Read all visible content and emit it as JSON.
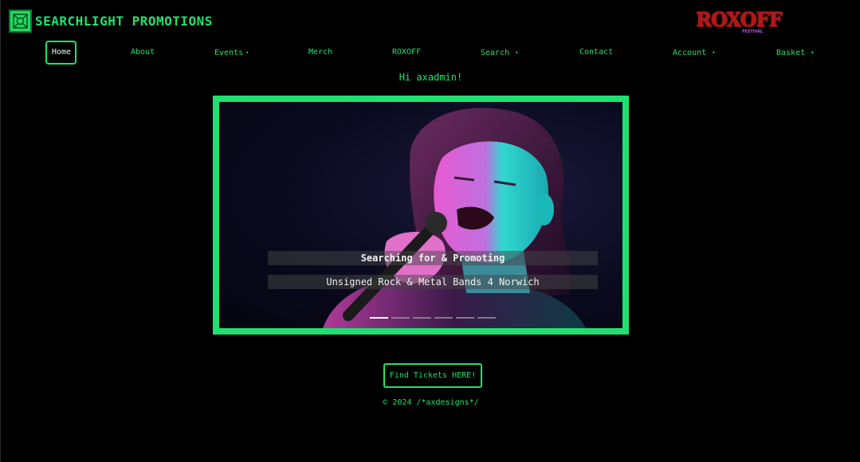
{
  "brand": {
    "name": "SEARCHLIGHT PROMOTIONS",
    "logo_icon": "searchlight-emblem",
    "partner_logo_text": "ROXOFF",
    "partner_logo_sub": "FESTIVAL"
  },
  "nav": {
    "items": [
      {
        "label": "Home",
        "active": true
      },
      {
        "label": "About"
      },
      {
        "label": "Events",
        "dropdown": true
      },
      {
        "label": "Merch"
      },
      {
        "label": "ROXOFF"
      },
      {
        "label": "Search",
        "dropdown": true
      },
      {
        "label": "Contact"
      },
      {
        "label": "Account",
        "dropdown": true
      },
      {
        "label": "Basket",
        "dropdown": true
      }
    ],
    "caret_icon": "▾"
  },
  "greeting": "Hi axadmin!",
  "carousel": {
    "caption_title": "Searching for & Promoting",
    "caption_text": "Unsigned Rock & Metal Bands 4 Norwich",
    "slide_count": 6,
    "active_slide": 1
  },
  "cta": {
    "label": "Find Tickets HERE!"
  },
  "footer": {
    "copyright": "© 2024 /*axdesigns*/"
  },
  "colors": {
    "accent": "#22e06a",
    "frame": "#1fe070",
    "background": "#000000",
    "partner_logo": "#b01818"
  }
}
